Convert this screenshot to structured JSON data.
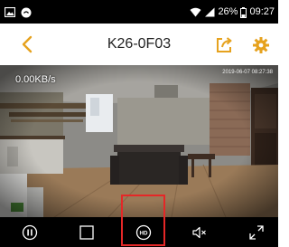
{
  "status_bar": {
    "battery_percent": "26%",
    "time": "09:27",
    "icons": [
      "image-icon",
      "circle-app-icon",
      "wifi-icon",
      "signal-icon",
      "battery-icon"
    ]
  },
  "header": {
    "title": "K26-0F03",
    "accent_color": "#e6a21e",
    "icons": [
      "chevron-left-icon",
      "share-icon",
      "gear-icon"
    ]
  },
  "video": {
    "bitrate": "0.00KB/s",
    "timestamp": "2019-06-07 08:27:38"
  },
  "controls": {
    "icons": [
      "pause-icon",
      "stop-icon",
      "hd-icon",
      "mute-icon",
      "fullscreen-icon"
    ],
    "highlighted": "hd-icon",
    "highlight_color": "#e52727"
  }
}
